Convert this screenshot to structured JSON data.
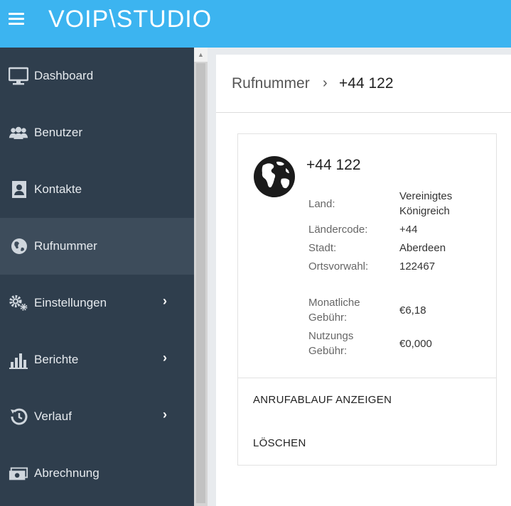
{
  "app": {
    "logo": "VOIP\\STUDIO",
    "brand_color": "#3cb4f0"
  },
  "sidebar": {
    "items": [
      {
        "label": "Dashboard",
        "icon": "monitor-icon",
        "has_chevron": false,
        "active": false
      },
      {
        "label": "Benutzer",
        "icon": "users-icon",
        "has_chevron": false,
        "active": false
      },
      {
        "label": "Kontakte",
        "icon": "contact-card-icon",
        "has_chevron": false,
        "active": false
      },
      {
        "label": "Rufnummer",
        "icon": "globe-icon",
        "has_chevron": false,
        "active": true
      },
      {
        "label": "Einstellungen",
        "icon": "gears-icon",
        "has_chevron": true,
        "active": false
      },
      {
        "label": "Berichte",
        "icon": "bar-chart-icon",
        "has_chevron": true,
        "active": false
      },
      {
        "label": "Verlauf",
        "icon": "history-icon",
        "has_chevron": true,
        "active": false
      },
      {
        "label": "Abrechnung",
        "icon": "money-icon",
        "has_chevron": false,
        "active": false
      }
    ],
    "chevron": "›"
  },
  "breadcrumb": {
    "root": "Rufnummer",
    "separator": "›",
    "current": "+44 122"
  },
  "number_card": {
    "title": "+44 122",
    "details": {
      "land_label": "Land:",
      "land_value": "Vereinigtes Königreich",
      "country_code_label": "Ländercode:",
      "country_code_value": "+44",
      "city_label": "Stadt:",
      "city_value": "Aberdeen",
      "area_code_label": "Ortsvorwahl:",
      "area_code_value": "122467",
      "monthly_fee_label": "Monatliche Gebühr:",
      "monthly_fee_value": "€6,18",
      "usage_fee_label": "Nutzungs Gebühr:",
      "usage_fee_value": "€0,000"
    },
    "actions": {
      "show_callflow": "ANRUFABLAUF ANZEIGEN",
      "delete": "LÖSCHEN"
    }
  }
}
